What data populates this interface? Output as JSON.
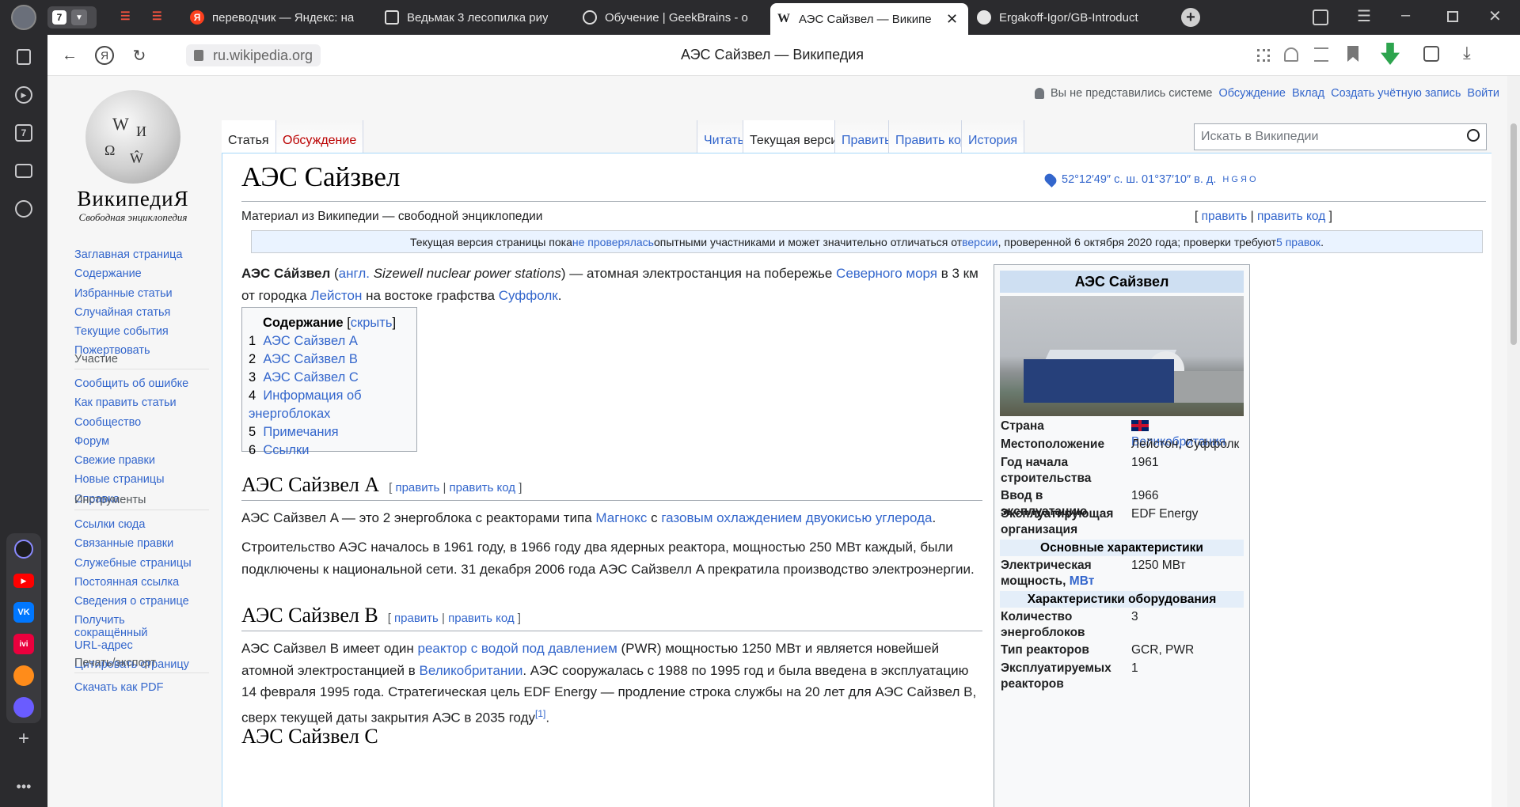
{
  "tabs": [
    {
      "label": "переводчик — Яндекс: на"
    },
    {
      "label": "Ведьмак 3 лесопилка риу"
    },
    {
      "label": "Обучение | GeekBrains - о"
    },
    {
      "label": "АЭС Сайзвел — Википе"
    },
    {
      "label": "Ergakoff-Igor/GB-Introduct"
    }
  ],
  "tab_count": "7",
  "url": "ru.wikipedia.org",
  "page_title": "АЭС Сайзвел — Википедия",
  "wiki": {
    "wordmark": "ВикипедиЯ",
    "tagline": "Свободная энциклопедия",
    "nav_main": [
      "Заглавная страница",
      "Содержание",
      "Избранные статьи",
      "Случайная статья",
      "Текущие события",
      "Пожертвовать"
    ],
    "nav_part_head": "Участие",
    "nav_part": [
      "Сообщить об ошибке",
      "Как править статьи",
      "Сообщество",
      "Форум",
      "Свежие правки",
      "Новые страницы",
      "Справка"
    ],
    "nav_tools_head": "Инструменты",
    "nav_tools": [
      "Ссылки сюда",
      "Связанные правки",
      "Служебные страницы",
      "Постоянная ссылка",
      "Сведения о странице",
      "Получить сокращённый URL-адрес",
      "Цитировать страницу"
    ],
    "nav_print_head": "Печать/экспорт",
    "nav_print": [
      "Скачать как PDF"
    ],
    "user_status": "Вы не представились системе",
    "top_links": [
      "Обсуждение",
      "Вклад",
      "Создать учётную запись",
      "Войти"
    ],
    "tab_article": "Статья",
    "tab_talk": "Обсуждение",
    "tab_read": "Читать",
    "tab_current": "Текущая версия",
    "tab_edit": "Править",
    "tab_editsrc": "Править код",
    "tab_history": "История",
    "search_placeholder": "Искать в Википедии"
  },
  "article": {
    "title": "АЭС Сайзвел",
    "coords": "52°12′49″ с. ш. 01°37′10″ в. д.",
    "coords_links": "H G Я O",
    "site_sub": "Материал из Википедии — свободной энциклопедии",
    "edit": "править",
    "edit_src": "править код",
    "notice_a": "Текущая версия страницы пока ",
    "notice_l1": "не проверялась",
    "notice_b": " опытными участниками и может значительно отличаться от ",
    "notice_l2": "версии",
    "notice_c": ", проверенной 6 октября 2020 года; проверки требуют ",
    "notice_l3": "5 правок",
    "intro_bold": "АЭС Са́йзвел",
    "intro_lang": "англ.",
    "intro_en": "Sizewell nuclear power stations",
    "intro_a": ") — атомная электростанция на побережье ",
    "intro_link1": "Северного моря",
    "intro_b": " в 3 км от городка ",
    "intro_link2": "Лейстон",
    "intro_c": " на востоке графства ",
    "intro_link3": "Суффолк",
    "toc_title": "Содержание",
    "toc_hide": "скрыть",
    "toc": [
      {
        "n": "1",
        "t": "АЭС Сайзвел A"
      },
      {
        "n": "2",
        "t": "АЭС Сайзвел B"
      },
      {
        "n": "3",
        "t": "АЭС Сайзвел C"
      },
      {
        "n": "4",
        "t": "Информация об энергоблоках"
      },
      {
        "n": "5",
        "t": "Примечания"
      },
      {
        "n": "6",
        "t": "Ссылки"
      }
    ],
    "h_a": "АЭС Сайзвел A",
    "a_p1_a": "АЭС Сайзвел A — это 2 энергоблока с реакторами типа ",
    "a_p1_l1": "Магнокс",
    "a_p1_b": " с ",
    "a_p1_l2": "газовым охлаждением двуокисью углерода",
    "a_p2": "Строительство АЭС началось в 1961 году, в 1966 году два ядерных реактора, мощностью 250 МВт каждый, были подключены к национальной сети. 31 декабря 2006 года АЭС Сайзвелл A прекратила производство электроэнергии.",
    "h_b": "АЭС Сайзвел B",
    "b_p1_a": "АЭС Сайзвел B имеет один ",
    "b_p1_l1": "реактор с водой под давлением",
    "b_p1_b": " (PWR) мощностью 1250 МВт и является новейшей атомной электростанцией в ",
    "b_p1_l2": "Великобритании",
    "b_p1_c": ". АЭС сооружалась с 1988 по 1995 год и была введена в эксплуатацию 14 февраля 1995 года. Стратегическая цель EDF Energy — продление строка службы на 20 лет для АЭС Сайзвел B, сверх текущей даты закрытия АЭС в 2035 году",
    "b_p1_ref": "[1]",
    "h_c": "АЭС Сайзвел C"
  },
  "infobox": {
    "title": "АЭС Сайзвел",
    "country_k": "Страна",
    "country_v": "Великобритания",
    "loc_k": "Местоположение",
    "loc_v": "Лейстон, Суффолк",
    "start_k": "Год начала строительства",
    "start_v": "1961",
    "comm_k": "Ввод в эксплуатацию",
    "comm_v": "1966",
    "op_k": "Эксплуатирующая организация",
    "op_v": "EDF Energy",
    "sec1": "Основные характеристики",
    "pow_k": "Электрическая мощность, ",
    "pow_unit": "МВт",
    "pow_v": "1250 МВт",
    "sec2": "Характеристики оборудования",
    "units_k": "Количество энергоблоков",
    "units_v": "3",
    "rtype_k": "Тип реакторов",
    "rtype_v": "GCR, PWR",
    "rop_k": "Эксплуатируемых реакторов",
    "rop_v": "1"
  }
}
